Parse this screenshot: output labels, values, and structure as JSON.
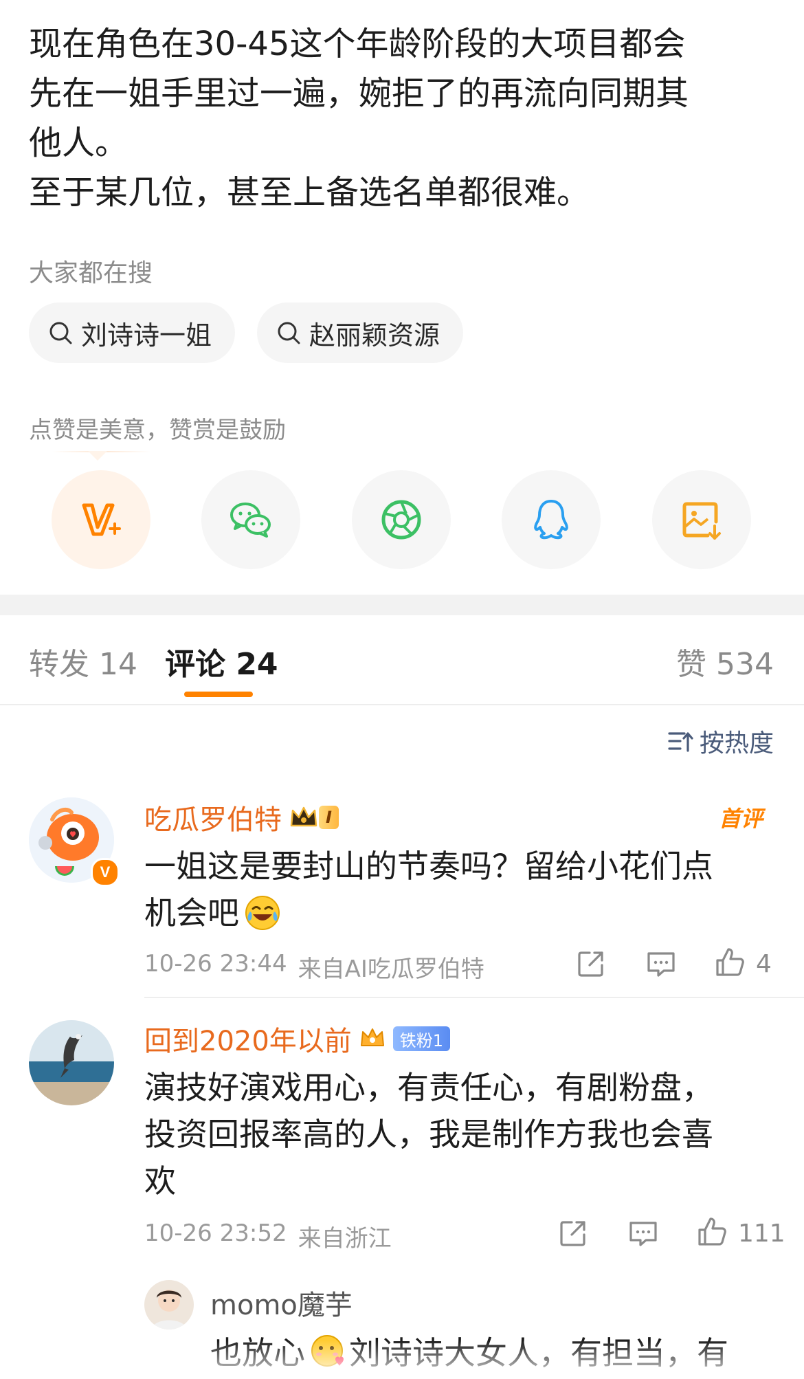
{
  "post": {
    "text": "现在角色在30-45这个年龄阶段的大项目都会\n先在一姐手里过一遍，婉拒了的再流向同期其\n他人。\n至于某几位，甚至上备选名单都很难。"
  },
  "trending": {
    "label": "大家都在搜",
    "chips": [
      {
        "label": "刘诗诗一姐"
      },
      {
        "label": "赵丽颖资源"
      }
    ]
  },
  "reward": {
    "label": "点赞是美意，赞赏是鼓励"
  },
  "share": {
    "items": [
      {
        "icon": "vip-reward-icon",
        "color": "#ff8200"
      },
      {
        "icon": "wechat-icon",
        "color": "#3cc064"
      },
      {
        "icon": "moments-icon",
        "color": "#3cc064"
      },
      {
        "icon": "qq-icon",
        "color": "#2a9ff0"
      },
      {
        "icon": "save-image-icon",
        "color": "#f5a623"
      }
    ]
  },
  "tabs": {
    "repost": "转发 14",
    "comments": "评论 24",
    "likes": "赞 534"
  },
  "sort": {
    "label": "按热度"
  },
  "comments": [
    {
      "username": "吃瓜罗伯特",
      "level": "I",
      "tag": "首评",
      "text_line1": "一姐这是要封山的节奏吗？留给小花们点",
      "text_line2": "机会吧",
      "emoji": "laugh-cry-emoji",
      "time": "10-26 23:44",
      "source": "来自AI吃瓜罗伯特",
      "likes": "4"
    },
    {
      "username": "回到2020年以前",
      "fan_badge": "铁粉1",
      "text": "演技好演戏用心，有责任心，有剧粉盘，\n投资回报率高的人，我是制作方我也会喜\n欢",
      "time": "10-26 23:52",
      "source": "来自浙江",
      "likes": "111"
    }
  ],
  "reply": {
    "username": "momo魔芋",
    "text_before": "也放心",
    "emoji": "love-emoji",
    "text_after": "刘诗诗大女人，有担当，有"
  },
  "colors": {
    "accent": "#ff8200",
    "username": "#e86a1e",
    "link": "#4a5b7a"
  }
}
